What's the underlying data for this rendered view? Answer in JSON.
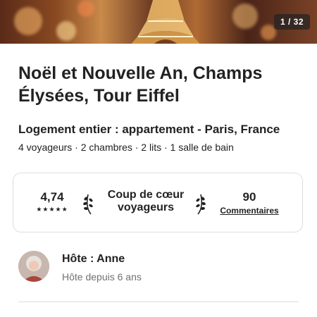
{
  "hero": {
    "image_counter": "1 / 32"
  },
  "listing": {
    "title": "Noël et Nouvelle An, Champs Élysées, Tour Eiffel",
    "subtitle": "Logement entier : appartement - Paris, France",
    "details": "4 voyageurs · 2 chambres · 2 lits · 1 salle de bain"
  },
  "highlights": {
    "rating": "4,74",
    "stars": "★★★★★",
    "guest_favorite_line1": "Coup de cœur",
    "guest_favorite_line2": "voyageurs",
    "reviews_count": "90",
    "reviews_label": "Commentaires"
  },
  "host": {
    "name": "Hôte : Anne",
    "since": "Hôte depuis 6 ans"
  },
  "icons": {
    "laurel_left": "laurel-left-icon",
    "laurel_right": "laurel-right-icon"
  },
  "colors": {
    "text": "#222222",
    "muted": "#717171",
    "border": "#dddddd"
  }
}
